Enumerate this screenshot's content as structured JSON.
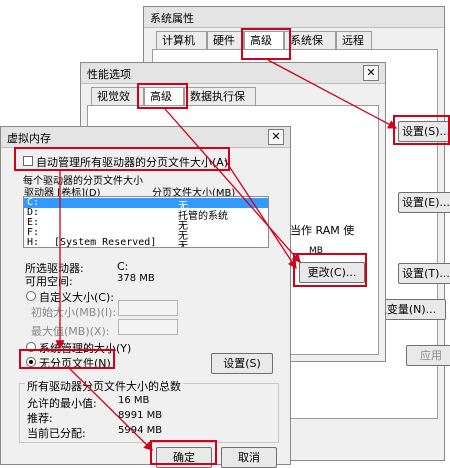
{
  "system_properties": {
    "title": "系统属性",
    "tabs": [
      "计算机名",
      "硬件",
      "高级",
      "系统保护",
      "远程"
    ],
    "settings_button_1": "设置(S)...",
    "settings_button_2": "设置(E)...",
    "settings_button_3": "设置(T)...",
    "env_vars_button": "境变量(N)...",
    "apply_button": "应用"
  },
  "performance_options": {
    "title": "性能选项",
    "tabs": [
      "视觉效果",
      "高级",
      "数据执行保护"
    ],
    "ram_text": "当作 RAM 使",
    "mb_text": "MB",
    "change_button": "更改(C)..."
  },
  "virtual_memory": {
    "title": "虚拟内存",
    "auto_manage_label": "自动管理所有驱动器的分页文件大小(A)",
    "per_drive_label": "每个驱动器的分页文件大小",
    "col_drive": "驱动器 [卷标](D)",
    "col_size": "分页文件大小(MB)",
    "drives": [
      {
        "drive": "C:",
        "label": "",
        "size": "无"
      },
      {
        "drive": "D:",
        "label": "",
        "size": "托管的系统"
      },
      {
        "drive": "E:",
        "label": "",
        "size": "无"
      },
      {
        "drive": "F:",
        "label": "",
        "size": "无"
      },
      {
        "drive": "H:",
        "label": "[System Reserved]",
        "size": "无"
      }
    ],
    "selected_drive_label": "所选驱动器:",
    "selected_drive_value": "C:",
    "available_space_label": "可用空间:",
    "available_space_value": "378 MB",
    "custom_size_label": "自定义大小(C):",
    "initial_size_label": "初始大小(MB)(I):",
    "max_size_label": "最大值(MB)(X):",
    "system_managed_label": "系统管理的大小(Y)",
    "no_paging_label": "无分页文件(N)",
    "set_button": "设置(S)",
    "total_group_title": "所有驱动器分页文件大小的总数",
    "min_allowed_label": "允许的最小值:",
    "min_allowed_value": "16 MB",
    "recommended_label": "推荐:",
    "recommended_value": "8991 MB",
    "allocated_label": "当前已分配:",
    "allocated_value": "5994 MB",
    "ok_button": "确定",
    "cancel_button": "取消"
  },
  "colors": {
    "highlight": "#d0021b",
    "selection": "#3399ff"
  }
}
